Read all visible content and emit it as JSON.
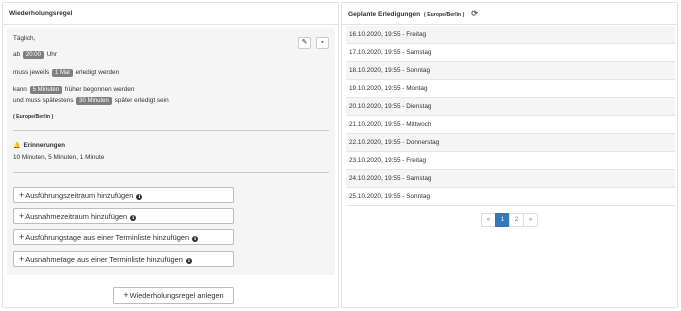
{
  "recurrence": {
    "header": "Wiederholungsregel",
    "daily": "Täglich,",
    "at_label": "ab",
    "time": "20:00",
    "clock_label": "Uhr",
    "must_prefix": "muss jeweils",
    "times_badge": "1 Mal",
    "must_suffix": "erledigt werden",
    "can_prefix": "kann",
    "early_badge": "5 Minuten",
    "can_suffix": "früher begonnen werden",
    "latest_prefix": "und muss spätestens",
    "late_badge": "30 Minuten",
    "latest_suffix": "später erledigt sein",
    "timezone": "( Europe/Berlin )",
    "reminders_title": "Erinnerungen",
    "reminders_value": "10 Minuten, 5 Minuten, 1 Minute",
    "buttons": [
      {
        "label": "Ausführungszeitraum hinzufügen"
      },
      {
        "label": "Ausnahmezeitraum hinzufügen"
      },
      {
        "label": "Ausführungstage aus einer Terminliste hinzufügen"
      },
      {
        "label": "Ausnahmetage aus einer Terminliste hinzufügen"
      }
    ],
    "create_button": "Wiederholungsregel anlegen"
  },
  "schedule": {
    "header": "Geplante Erledigungen",
    "timezone": "( Europe/Berlin )",
    "items": [
      "16.10.2020, 19:55 - Freitag",
      "17.10.2020, 19:55 - Samstag",
      "18.10.2020, 19:55 - Sonntag",
      "19.10.2020, 19:55 - Montag",
      "20.10.2020, 19:55 - Dienstag",
      "21.10.2020, 19:55 - Mittwoch",
      "22.10.2020, 19:55 - Donnerstag",
      "23.10.2020, 19:55 - Freitag",
      "24.10.2020, 19:55 - Samstag",
      "25.10.2020, 19:55 - Sonntag"
    ],
    "pagination": {
      "prev": "«",
      "pages": [
        "1",
        "2"
      ],
      "next": "»",
      "current": "1"
    }
  },
  "icons": {
    "edit": "pencil-icon",
    "delete": "trash-icon",
    "bell": "bell-icon",
    "info": "info-icon",
    "refresh": "refresh-icon",
    "plus": "plus-icon"
  },
  "colors": {
    "badge": "#7f7f7f",
    "panel_bg": "#f5f5f5",
    "active_page": "#337ab7",
    "delete": "#c0392b"
  }
}
